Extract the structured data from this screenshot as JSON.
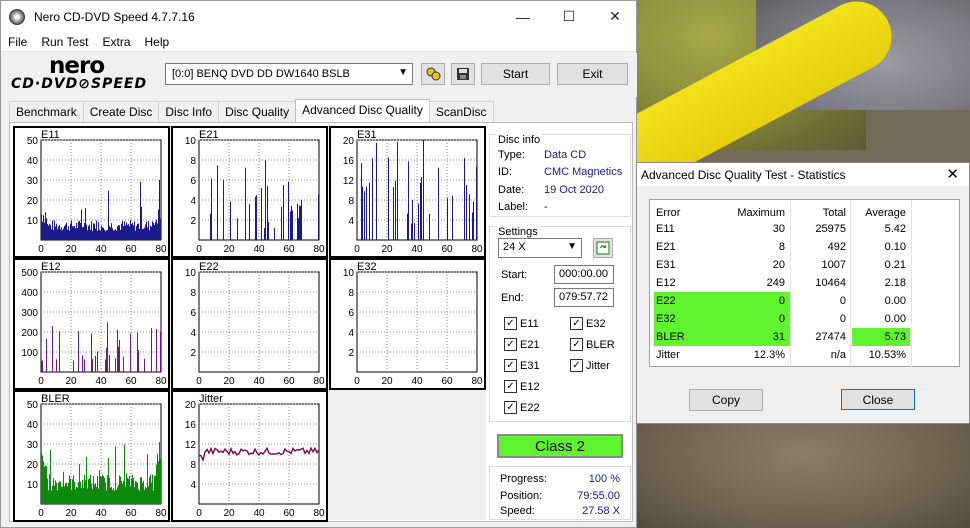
{
  "window": {
    "title": "Nero CD-DVD Speed 4.7.7.16",
    "minimize": "—",
    "maximize": "☐",
    "close": "✕"
  },
  "menu": [
    "File",
    "Run Test",
    "Extra",
    "Help"
  ],
  "logo": {
    "top": "nero",
    "bottom": "CD·DVD⊘SPEED"
  },
  "toolbar": {
    "drive": "[0:0]   BENQ DVD DD DW1640 BSLB",
    "start": "Start",
    "exit": "Exit"
  },
  "tabs": [
    "Benchmark",
    "Create Disc",
    "Disc Info",
    "Disc Quality",
    "Advanced Disc Quality",
    "ScanDisc"
  ],
  "active_tab": 4,
  "disc_info": {
    "title": "Disc info",
    "type_label": "Type:",
    "type": "Data CD",
    "id_label": "ID:",
    "id": "CMC Magnetics",
    "date_label": "Date:",
    "date": "19 Oct 2020",
    "label_label": "Label:",
    "label": "-"
  },
  "settings": {
    "title": "Settings",
    "speed": "24 X",
    "start_label": "Start:",
    "start": "000:00.00",
    "end_label": "End:",
    "end": "079:57.72"
  },
  "checkboxes": [
    "E11",
    "E32",
    "E21",
    "BLER",
    "E31",
    "Jitter",
    "E12",
    "E22"
  ],
  "class_label": "Class 2",
  "progress": {
    "progress_label": "Progress:",
    "progress": "100 %",
    "position_label": "Position:",
    "position": "79:55.00",
    "speed_label": "Speed:",
    "speed": "27.58 X"
  },
  "colors": {
    "e11": "#1a1a8c",
    "e21": "#1a1a8c",
    "e31": "#1a1a8c",
    "e12": "#6a1a8c",
    "bler": "#0c8a0c",
    "jitter": "#7a0c3a",
    "green": "#5ff42e"
  },
  "chart_data": [
    {
      "type": "bar",
      "name": "E11",
      "ylim": [
        0,
        50
      ],
      "yticks": [
        "50",
        "40",
        "30",
        "20",
        "10"
      ],
      "xticks": [
        "0",
        "20",
        "40",
        "60",
        "80"
      ],
      "baseline": 8,
      "peak": 30
    },
    {
      "type": "bar",
      "name": "E21",
      "ylim": [
        0,
        10
      ],
      "yticks": [
        "10",
        "8",
        "6",
        "4",
        "2"
      ],
      "xticks": [
        "0",
        "20",
        "40",
        "60",
        "80"
      ],
      "peak": 8
    },
    {
      "type": "bar",
      "name": "E31",
      "ylim": [
        0,
        20
      ],
      "yticks": [
        "20",
        "16",
        "12",
        "8",
        "4"
      ],
      "xticks": [
        "0",
        "20",
        "40",
        "60",
        "80"
      ],
      "peak": 20
    },
    {
      "type": "bar",
      "name": "E12",
      "ylim": [
        0,
        500
      ],
      "yticks": [
        "500",
        "400",
        "300",
        "200",
        "100"
      ],
      "xticks": [
        "0",
        "20",
        "40",
        "60",
        "80"
      ],
      "peak": 249
    },
    {
      "type": "bar",
      "name": "E22",
      "ylim": [
        0,
        10
      ],
      "yticks": [
        "10",
        "8",
        "6",
        "4",
        "2"
      ],
      "xticks": [
        "0",
        "20",
        "40",
        "60",
        "80"
      ],
      "peak": 0
    },
    {
      "type": "bar",
      "name": "E32",
      "ylim": [
        0,
        10
      ],
      "yticks": [
        "10",
        "8",
        "6",
        "4",
        "2"
      ],
      "xticks": [
        "0",
        "20",
        "40",
        "60",
        "80"
      ],
      "peak": 0
    },
    {
      "type": "bar",
      "name": "BLER",
      "ylim": [
        0,
        50
      ],
      "yticks": [
        "50",
        "40",
        "30",
        "20",
        "10"
      ],
      "xticks": [
        "0",
        "20",
        "40",
        "60",
        "80"
      ],
      "baseline": 12,
      "peak": 31
    },
    {
      "type": "line",
      "name": "Jitter",
      "ylim": [
        0,
        20
      ],
      "yticks": [
        "20",
        "16",
        "12",
        "8",
        "4"
      ],
      "xticks": [
        "0",
        "20",
        "40",
        "60",
        "80"
      ],
      "level": 10.5
    }
  ],
  "dialog": {
    "title": "Advanced Disc Quality Test - Statistics",
    "headers": [
      "Error",
      "Maximum",
      "Total",
      "Average"
    ],
    "rows": [
      [
        "E11",
        "30",
        "25975",
        "5.42"
      ],
      [
        "E21",
        "8",
        "492",
        "0.10"
      ],
      [
        "E31",
        "20",
        "1007",
        "0.21"
      ],
      [
        "E12",
        "249",
        "10464",
        "2.18"
      ],
      [
        "E22",
        "0",
        "0",
        "0.00"
      ],
      [
        "E32",
        "0",
        "0",
        "0.00"
      ],
      [
        "BLER",
        "31",
        "27474",
        "5.73"
      ],
      [
        "Jitter",
        "12.3%",
        "n/a",
        "10.53%"
      ]
    ],
    "copy": "Copy",
    "close": "Close"
  }
}
